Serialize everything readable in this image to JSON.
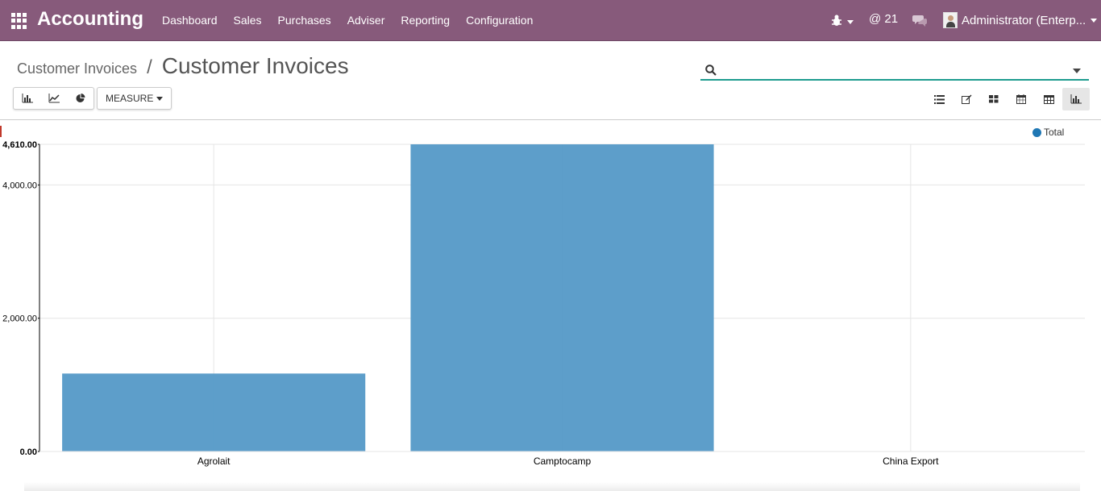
{
  "app": {
    "title": "Accounting"
  },
  "nav": {
    "menu": [
      "Dashboard",
      "Sales",
      "Purchases",
      "Adviser",
      "Reporting",
      "Configuration"
    ],
    "messages_count": "@ 21",
    "user_label": "Administrator (Enterp..."
  },
  "breadcrumb": {
    "parent": "Customer Invoices",
    "separator": "/",
    "current": "Customer Invoices"
  },
  "search": {
    "value": "",
    "placeholder": ""
  },
  "toolbar": {
    "chart_type_buttons": [
      "bar-chart-icon",
      "line-chart-icon",
      "pie-chart-icon"
    ],
    "measure_label": "MEASURE",
    "views": [
      "list-view-icon",
      "form-view-icon",
      "kanban-view-icon",
      "calendar-view-icon",
      "pivot-view-icon",
      "graph-view-icon"
    ],
    "active_view": "graph-view-icon"
  },
  "colors": {
    "navbar": "#875a7b",
    "bar": "#5499c7",
    "legend": "#1f77b4",
    "search_accent": "#1d9c8f"
  },
  "chart_data": {
    "type": "bar",
    "categories": [
      "Agrolait",
      "Camptocamp",
      "China Export"
    ],
    "series": [
      {
        "name": "Total",
        "values": [
          1170,
          4610,
          0
        ]
      }
    ],
    "y_ticks": [
      "0.00",
      "2,000.00",
      "4,000.00",
      "4,610.00"
    ],
    "ylim": [
      0,
      4610
    ],
    "grid": true,
    "legend_position": "top-right"
  }
}
